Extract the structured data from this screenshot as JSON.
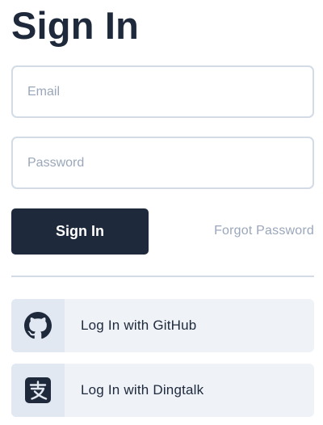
{
  "title": "Sign In",
  "form": {
    "email_placeholder": "Email",
    "email_value": "",
    "password_placeholder": "Password",
    "password_value": "",
    "submit_label": "Sign In",
    "forgot_label": "Forgot Password"
  },
  "social": [
    {
      "label": "Log In with GitHub",
      "icon": "github-icon"
    },
    {
      "label": "Log In with Dingtalk",
      "icon": "dingtalk-icon"
    }
  ],
  "colors": {
    "primary": "#1e293b",
    "muted_text": "#9aa7ba",
    "border": "#d3dbe6",
    "social_bg": "#eff3f8",
    "social_icon_bg": "#e2e8f1"
  }
}
